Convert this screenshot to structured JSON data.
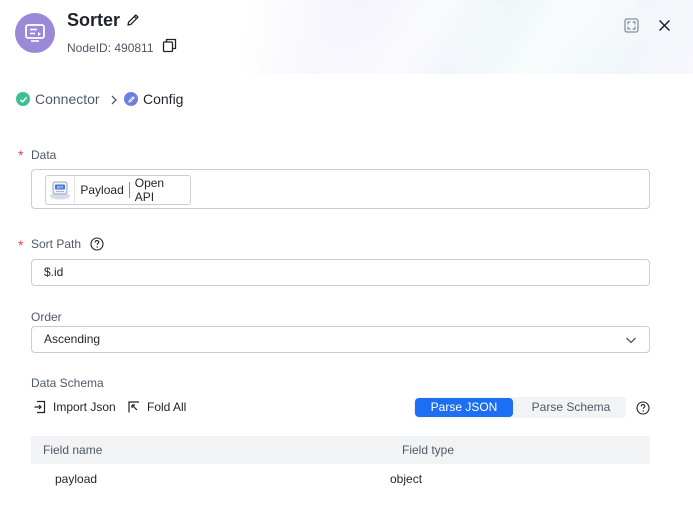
{
  "node": {
    "title": "Sorter",
    "node_id": "NodeID: 490811"
  },
  "breadcrumb": {
    "step1": "Connector",
    "step2": "Config"
  },
  "form": {
    "data": {
      "label": "Data",
      "chip": {
        "source": "Payload",
        "connector": "Open API"
      }
    },
    "sort_path": {
      "label": "Sort Path",
      "value": "$.id"
    },
    "order": {
      "label": "Order",
      "value": "Ascending"
    },
    "data_schema": {
      "label": "Data Schema",
      "import_label": "Import Json",
      "fold_label": "Fold All",
      "parse_json": "Parse JSON",
      "parse_schema": "Parse Schema",
      "table": {
        "columns": [
          "Field name",
          "Field type"
        ],
        "rows": [
          {
            "name": "payload",
            "type": "object"
          }
        ]
      }
    }
  },
  "colors": {
    "accent": "#1c6ef3",
    "success": "#3fbf8f",
    "step_active": "#6f7fe0",
    "avatar": "#9b88d6",
    "required": "#f53f3f"
  },
  "icons": {
    "avatar": "sorter-icon",
    "edit": "pencil-icon",
    "copy": "copy-icon",
    "expand": "expand-icon",
    "close": "close-icon",
    "help": "question-circle-icon",
    "import": "import-icon",
    "fold": "fold-icon"
  }
}
